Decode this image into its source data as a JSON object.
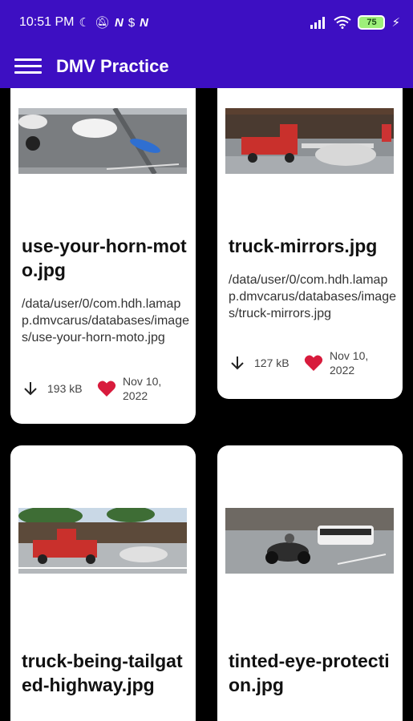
{
  "status_bar": {
    "time": "10:51 PM",
    "left_icons": [
      "moon-icon",
      "bell-off-icon",
      "n-icon",
      "dollar-icon",
      "n-icon"
    ],
    "right_icons": [
      "signal-icon",
      "wifi-icon",
      "battery-icon",
      "charging-icon"
    ],
    "battery_level": "75"
  },
  "app_bar": {
    "title": "DMV Practice"
  },
  "cards": [
    {
      "name": "use-your-horn-moto.jpg",
      "path": "/data/user/0/com.hdh.lamapp.dmvcarus/databases/images/use-your-horn-moto.jpg",
      "size": "193 kB",
      "date": "Nov 10, 2022",
      "favorite": true
    },
    {
      "name": "truck-mirrors.jpg",
      "path": "/data/user/0/com.hdh.lamapp.dmvcarus/databases/images/truck-mirrors.jpg",
      "size": "127 kB",
      "date": "Nov 10, 2022",
      "favorite": true
    },
    {
      "name": "truck-being-tailgated-highway.jpg"
    },
    {
      "name": "tinted-eye-protection.jpg"
    }
  ],
  "colors": {
    "primary": "#3d0fc2",
    "heart": "#d81b3c",
    "background": "#000000"
  }
}
